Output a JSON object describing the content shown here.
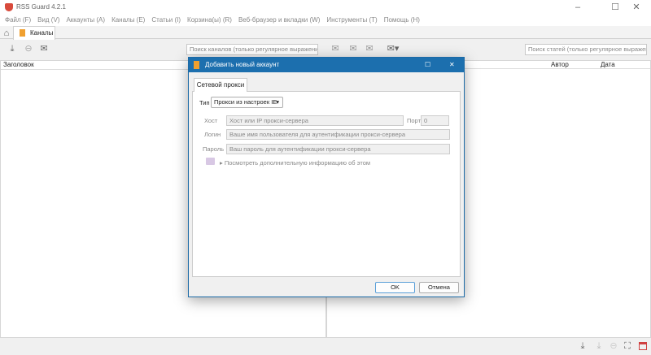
{
  "app": {
    "title": "RSS Guard 4.2.1"
  },
  "menu": [
    "Файл (F)",
    "Вид (V)",
    "Аккаунты (A)",
    "Каналы (E)",
    "Статьи (I)",
    "Корзина(ы) (R)",
    "Веб-браузер и вкладки (W)",
    "Инструменты (T)",
    "Помощь (H)"
  ],
  "tabs": {
    "feeds": "Каналы"
  },
  "feeds": {
    "search_placeholder": "Поиск каналов (только регулярное выражение)",
    "col_title": "Заголовок"
  },
  "messages": {
    "search_placeholder": "Поиск статей (только регулярное выражение)",
    "col_author": "Автор",
    "col_date": "Дата"
  },
  "dialog": {
    "title": "Добавить новый аккаунт",
    "tab": "Сетевой прокси",
    "type_label": "Тип",
    "type_value": "Прокси из настроек IE",
    "host_label": "Хост",
    "host_placeholder": "Хост или IP прокси-сервера",
    "port_label": "Порт",
    "port_value": "0",
    "login_label": "Логин",
    "login_placeholder": "Ваше имя пользователя для аутентификации прокси-сервера",
    "password_label": "Пароль",
    "password_placeholder": "Ваш пароль для аутентификации прокси-сервера",
    "info_link": "Посмотреть дополнительную информацию об этом",
    "ok": "OK",
    "cancel": "Отмена"
  },
  "colors": {
    "accent": "#1c6fae"
  }
}
